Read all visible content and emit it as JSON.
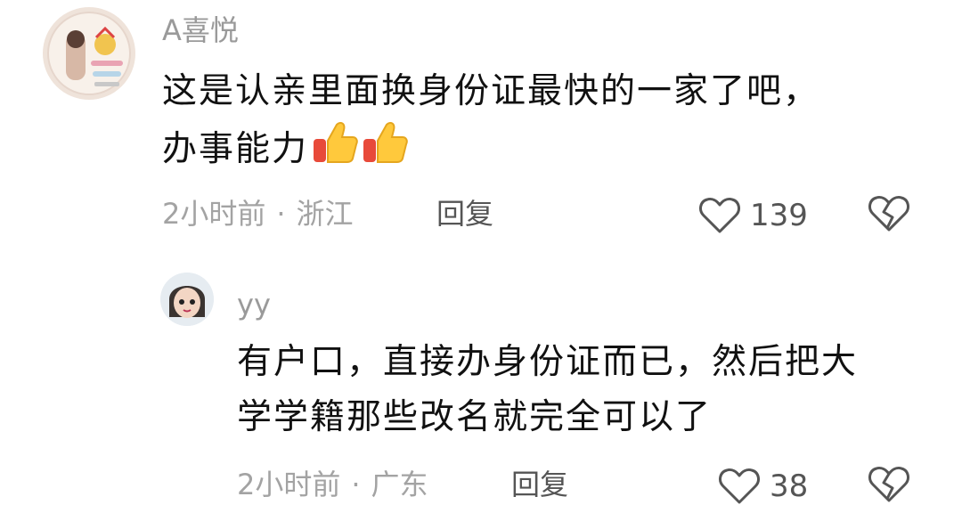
{
  "comments": [
    {
      "username": "A喜悦",
      "text_lines": [
        "这是认亲里面换身份证最快的一家了吧，",
        "办事能力"
      ],
      "emoji": [
        "thumbs-up-icon",
        "thumbs-up-icon"
      ],
      "time": "2小时前",
      "separator": "·",
      "location": "浙江",
      "reply_label": "回复",
      "like_count": "139"
    },
    {
      "username": "yy",
      "text_lines": [
        "有户口，直接办身份证而已，然后把大",
        "学学籍那些改名就完全可以了"
      ],
      "time": "2小时前",
      "separator": "·",
      "location": "广东",
      "reply_label": "回复",
      "like_count": "38"
    }
  ],
  "colors": {
    "username": "#9a9a9a",
    "meta": "#a3a3a3",
    "body": "#111111",
    "icon": "#555555"
  }
}
